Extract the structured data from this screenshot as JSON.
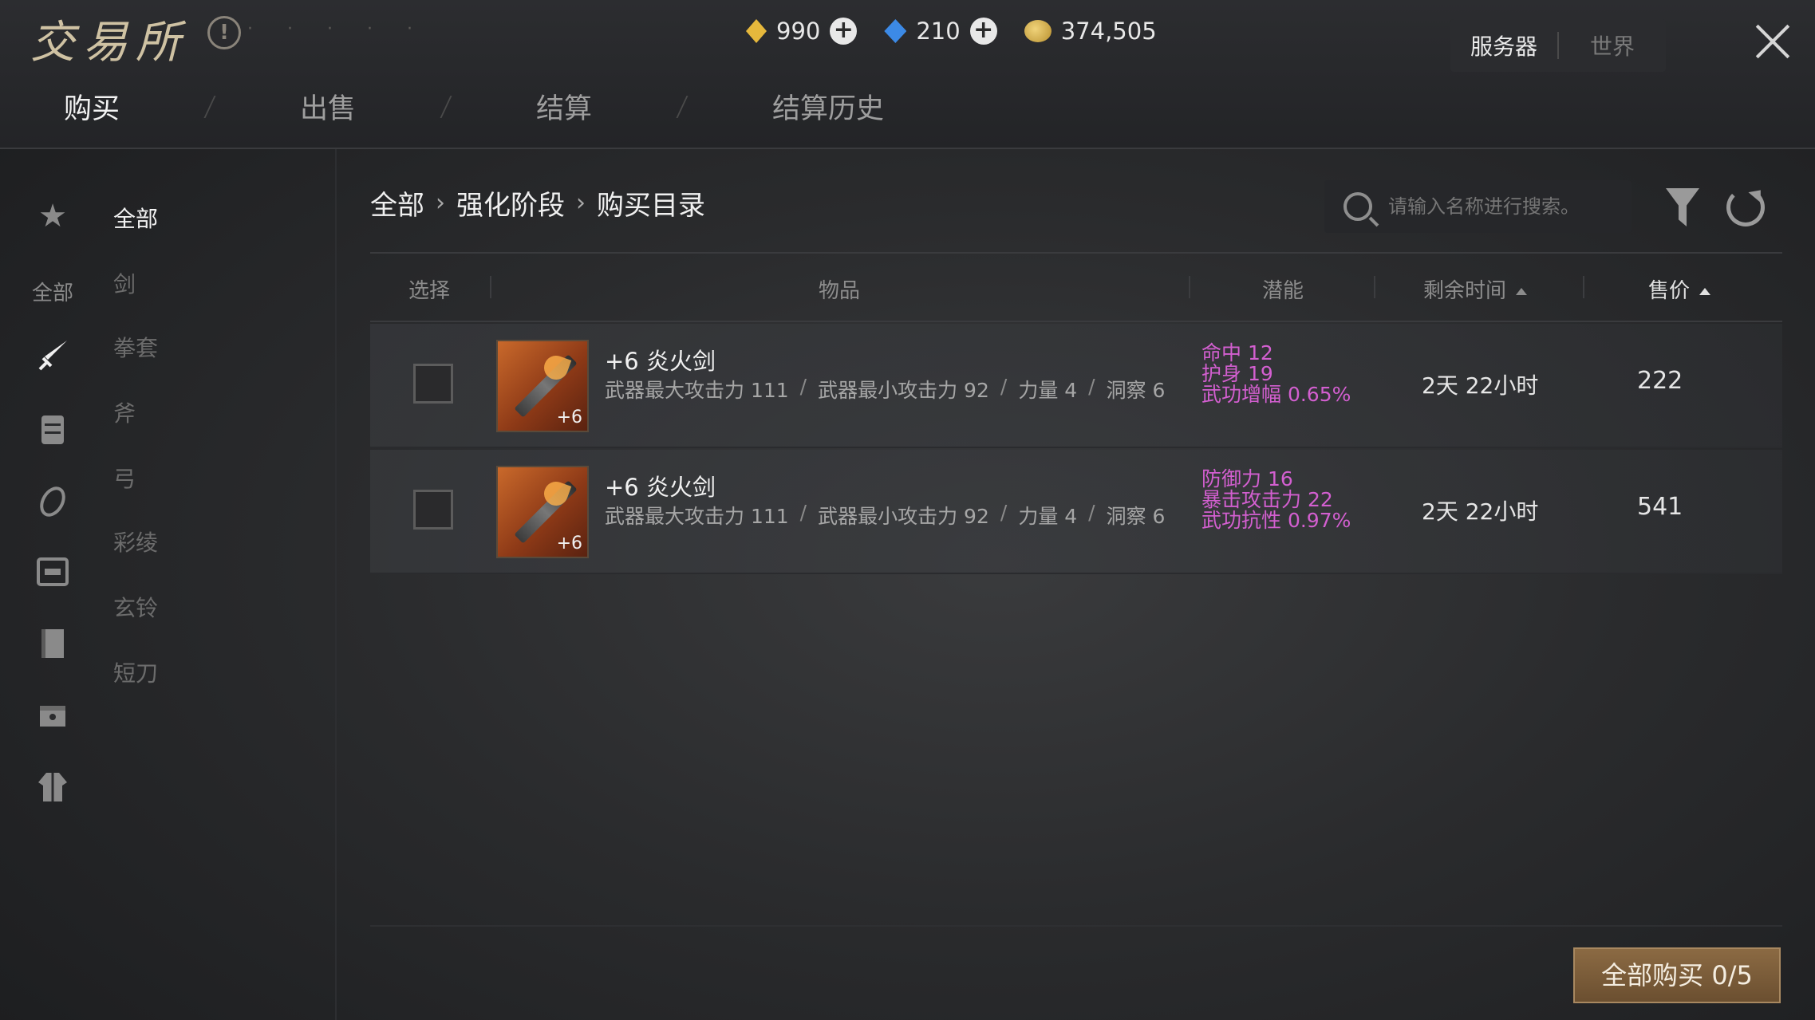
{
  "header": {
    "title": "交易所",
    "faint_note": "· · · · ·",
    "currencies": [
      {
        "icon": "gold-gem-icon",
        "value": "990"
      },
      {
        "icon": "blue-gem-icon",
        "value": "210"
      },
      {
        "icon": "coin-icon",
        "value": "374,505"
      }
    ],
    "scope": {
      "server": "服务器",
      "world": "世界"
    }
  },
  "tabs": [
    "购买",
    "出售",
    "结算",
    "结算历史"
  ],
  "sidebar": {
    "icons": [
      "star-icon",
      "sword-icon",
      "armor-icon",
      "ring-icon",
      "chest-icon",
      "book-icon",
      "box-icon",
      "robe-icon"
    ],
    "icon_label": "全部",
    "categories": [
      "全部",
      "剑",
      "拳套",
      "斧",
      "弓",
      "彩绫",
      "玄铃",
      "短刀"
    ]
  },
  "breadcrumb": [
    "全部",
    "强化阶段",
    "购买目录"
  ],
  "search": {
    "placeholder": "请输入名称进行搜索。"
  },
  "table": {
    "headers": {
      "select": "选择",
      "item": "物品",
      "potential": "潜能",
      "time_left": "剩余时间",
      "price": "售价"
    },
    "rows": [
      {
        "name": "+6 炎火剑",
        "badge": "+6",
        "stats": [
          "武器最大攻击力 111",
          "武器最小攻击力 92",
          "力量 4",
          "洞察 6"
        ],
        "potential": [
          "命中 12",
          "护身 19",
          "武功增幅 0.65%"
        ],
        "time_left": "2天 22小时",
        "price": "222"
      },
      {
        "name": "+6 炎火剑",
        "badge": "+6",
        "stats": [
          "武器最大攻击力 111",
          "武器最小攻击力 92",
          "力量 4",
          "洞察 6"
        ],
        "potential": [
          "防御力 16",
          "暴击攻击力 22",
          "武功抗性 0.97%"
        ],
        "time_left": "2天 22小时",
        "price": "541"
      }
    ]
  },
  "footer": {
    "buy_all_label": "全部购买 0/5"
  },
  "colors": {
    "potential": "#d35fd0",
    "buy_button": "#7b5c39"
  }
}
